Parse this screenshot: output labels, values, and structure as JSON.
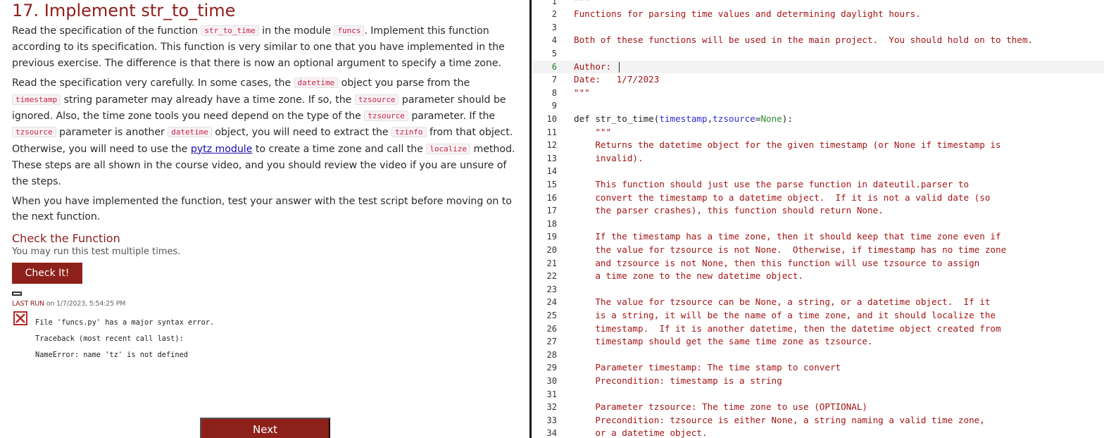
{
  "exercise": {
    "title": "17. Implement str_to_time",
    "p1": {
      "t1": "Read the specification of the function ",
      "c1": "str_to_time",
      "t2": " in the module ",
      "c2": "funcs",
      "t3": ". Implement this function according to its specification. This function is very similar to one that you have implemented in the previous exercise. The difference is that there is now an optional argument to specify a time zone."
    },
    "p2": {
      "t1": "Read the specification very carefully. In some cases, the ",
      "c1": "datetime",
      "t2": " object you parse from the ",
      "c2": "timestamp",
      "t3": " string parameter may already have a time zone. If so, the ",
      "c3": "tzsource",
      "t4": " parameter should be ignored. Also, the time zone tools you need depend on the type of the ",
      "c4": "tzsource",
      "t5": " parameter. If the ",
      "c5": "tzsource",
      "t6": " parameter is another ",
      "c6": "datetime",
      "t7": " object, you will need to extract the ",
      "c7": "tzinfo",
      "t8": " from that object. Otherwise, you will need to use the ",
      "link": "pytz module",
      "t9": " to create a time zone and call the ",
      "c8": "localize",
      "t10": " method. These steps are all shown in the course video, and you should review the video if you are unsure of the steps."
    },
    "p3": "When you have implemented the function, test your answer with the test script before moving on to the next function."
  },
  "check": {
    "title": "Check the Function",
    "subtitle": "You may run this test multiple times.",
    "button": "Check It!",
    "last_run_label": "LAST RUN",
    "last_run_value": " on 1/7/2023, 5:54:25 PM",
    "status_icon": "fail-x-icon",
    "output": [
      "File 'funcs.py' has a major syntax error.",
      "Traceback (most recent call last):",
      "NameError: name 'tz' is not defined"
    ]
  },
  "next_button": "Next",
  "colors": {
    "accent": "#8e201c",
    "string": "#a31515",
    "param": "#2d2dd6",
    "none_keyword": "#2a8a2a"
  },
  "editor": {
    "active_line": 6,
    "lines": [
      {
        "n": "1",
        "text": "\"\"\""
      },
      {
        "n": "2",
        "text": "Functions for parsing time values and determining daylight hours."
      },
      {
        "n": "3",
        "text": ""
      },
      {
        "n": "4",
        "text": "Both of these functions will be used in the main project.  You should hold on to them."
      },
      {
        "n": "5",
        "text": ""
      },
      {
        "n": "6",
        "text": "Author: "
      },
      {
        "n": "7",
        "text": "Date:   1/7/2023"
      },
      {
        "n": "8",
        "text": "\"\"\""
      },
      {
        "n": "9",
        "text": ""
      },
      {
        "n": "10",
        "def": {
          "kw": "def str_to_time(",
          "p1": "timestamp",
          "comma": ",",
          "p2": "tzsource",
          "eq": "=",
          "none": "None",
          "end": "):"
        }
      },
      {
        "n": "11",
        "text": "    \"\"\""
      },
      {
        "n": "12",
        "text": "    Returns the datetime object for the given timestamp (or None if timestamp is"
      },
      {
        "n": "13",
        "text": "    invalid)."
      },
      {
        "n": "14",
        "text": ""
      },
      {
        "n": "15",
        "text": "    This function should just use the parse function in dateutil.parser to"
      },
      {
        "n": "16",
        "text": "    convert the timestamp to a datetime object.  If it is not a valid date (so"
      },
      {
        "n": "17",
        "text": "    the parser crashes), this function should return None."
      },
      {
        "n": "18",
        "text": ""
      },
      {
        "n": "19",
        "text": "    If the timestamp has a time zone, then it should keep that time zone even if"
      },
      {
        "n": "20",
        "text": "    the value for tzsource is not None.  Otherwise, if timestamp has no time zone"
      },
      {
        "n": "21",
        "text": "    and tzsource is not None, then this function will use tzsource to assign"
      },
      {
        "n": "22",
        "text": "    a time zone to the new datetime object."
      },
      {
        "n": "23",
        "text": ""
      },
      {
        "n": "24",
        "text": "    The value for tzsource can be None, a string, or a datetime object.  If it"
      },
      {
        "n": "25",
        "text": "    is a string, it will be the name of a time zone, and it should localize the"
      },
      {
        "n": "26",
        "text": "    timestamp.  If it is another datetime, then the datetime object created from"
      },
      {
        "n": "27",
        "text": "    timestamp should get the same time zone as tzsource."
      },
      {
        "n": "28",
        "text": ""
      },
      {
        "n": "29",
        "text": "    Parameter timestamp: The time stamp to convert"
      },
      {
        "n": "30",
        "text": "    Precondition: timestamp is a string"
      },
      {
        "n": "31",
        "text": ""
      },
      {
        "n": "32",
        "text": "    Parameter tzsource: The time zone to use (OPTIONAL)"
      },
      {
        "n": "33",
        "text": "    Precondition: tzsource is either None, a string naming a valid time zone,"
      },
      {
        "n": "34",
        "text": "    or a datetime object."
      }
    ]
  }
}
